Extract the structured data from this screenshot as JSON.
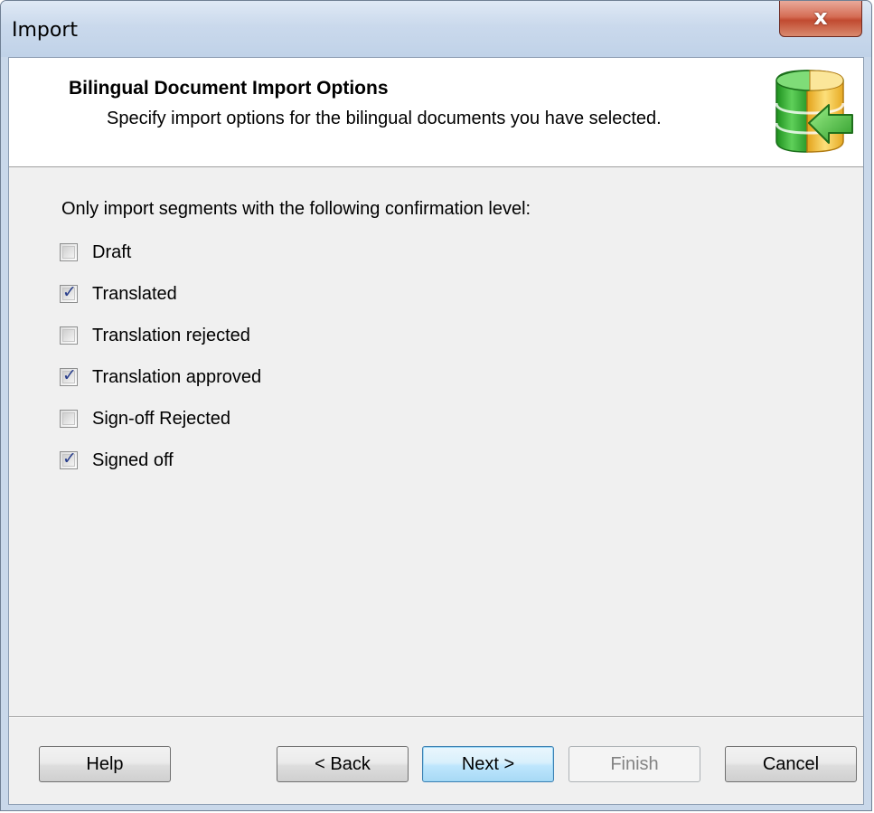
{
  "window": {
    "title": "Import",
    "close_glyph": "x"
  },
  "header": {
    "title": "Bilingual Document Import Options",
    "subtitle": "Specify import options for the bilingual documents you have selected.",
    "icon": "database-import-icon"
  },
  "options": {
    "prompt": "Only import segments with the following confirmation level:",
    "items": [
      {
        "label": "Draft",
        "checked": false
      },
      {
        "label": "Translated",
        "checked": true
      },
      {
        "label": "Translation rejected",
        "checked": false
      },
      {
        "label": "Translation approved",
        "checked": true
      },
      {
        "label": "Sign-off Rejected",
        "checked": false
      },
      {
        "label": "Signed off",
        "checked": true
      }
    ]
  },
  "buttons": {
    "help": "Help",
    "back": "< Back",
    "next": "Next >",
    "finish": "Finish",
    "cancel": "Cancel"
  },
  "colors": {
    "accent": "#3c7fb1",
    "checkmark": "#2a3f8c",
    "close_button": "#c14a30"
  }
}
